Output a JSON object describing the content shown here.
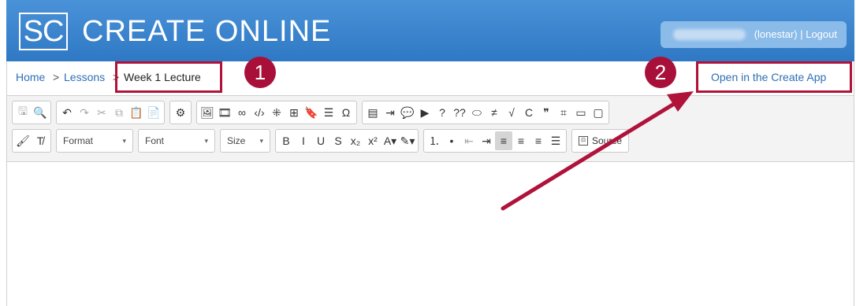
{
  "header": {
    "logo_text": "SC",
    "app_name": "CREATE ONLINE",
    "user_text": "(lonestar) | Logout"
  },
  "breadcrumb": {
    "home": "Home",
    "sep1": ">",
    "lessons": "Lessons",
    "sep2": ">",
    "current": "Week 1 Lecture"
  },
  "open_app_link": "Open in the Create App",
  "callouts": {
    "badge1": "1",
    "badge2": "2",
    "highlight_color": "#b0123a",
    "badge_color": "#a8103a"
  },
  "toolbar": {
    "format_label": "Format",
    "font_label": "Font",
    "size_label": "Size",
    "source_label": "Source",
    "row1_groups": [
      [
        {
          "icon": "save-icon",
          "glyph": "🖫",
          "disabled": true
        },
        {
          "icon": "preview-icon",
          "glyph": "🔍",
          "disabled": false
        }
      ],
      [
        {
          "icon": "undo-icon",
          "glyph": "↶",
          "disabled": false
        },
        {
          "icon": "redo-icon",
          "glyph": "↷",
          "disabled": true
        },
        {
          "icon": "cut-icon",
          "glyph": "✂",
          "disabled": true
        },
        {
          "icon": "copy-icon",
          "glyph": "⧉",
          "disabled": true
        },
        {
          "icon": "paste-icon",
          "glyph": "📋",
          "disabled": true
        },
        {
          "icon": "paste-text-icon",
          "glyph": "📄",
          "disabled": true
        }
      ],
      [
        {
          "icon": "gear-icon",
          "glyph": "⚙",
          "disabled": false
        }
      ],
      [
        {
          "icon": "image-icon",
          "glyph": "🖼",
          "disabled": false
        },
        {
          "icon": "media-icon",
          "glyph": "🎞",
          "disabled": false
        },
        {
          "icon": "link-icon",
          "glyph": "∞",
          "disabled": false
        },
        {
          "icon": "code-icon",
          "glyph": "‹/›",
          "disabled": false
        },
        {
          "icon": "widget-icon",
          "glyph": "⁜",
          "disabled": false
        },
        {
          "icon": "table-icon",
          "glyph": "⊞",
          "disabled": false
        },
        {
          "icon": "bookmark-icon",
          "glyph": "🔖",
          "disabled": false
        },
        {
          "icon": "horizontal-line-icon",
          "glyph": "☰",
          "disabled": false
        },
        {
          "icon": "omega-icon",
          "glyph": "Ω",
          "disabled": false
        }
      ],
      [
        {
          "icon": "template-icon",
          "glyph": "▤",
          "disabled": false
        },
        {
          "icon": "list-insert-icon",
          "glyph": "⇥",
          "disabled": false
        },
        {
          "icon": "comment-icon",
          "glyph": "💬",
          "disabled": false
        },
        {
          "icon": "play-icon",
          "glyph": "▶",
          "disabled": false
        },
        {
          "icon": "question-icon",
          "glyph": "?",
          "disabled": false
        },
        {
          "icon": "double-question-icon",
          "glyph": "??",
          "disabled": false
        },
        {
          "icon": "callout-icon",
          "glyph": "⬭",
          "disabled": false
        },
        {
          "icon": "strike-list-icon",
          "glyph": "≠",
          "disabled": false
        },
        {
          "icon": "sqrt-icon",
          "glyph": "√",
          "disabled": false
        },
        {
          "icon": "chemistry-icon",
          "glyph": "C",
          "disabled": false
        },
        {
          "icon": "quote-icon",
          "glyph": "❞",
          "disabled": false
        },
        {
          "icon": "div-icon",
          "glyph": "⌗",
          "disabled": false
        },
        {
          "icon": "layout-icon",
          "glyph": "▭",
          "disabled": false
        },
        {
          "icon": "frame-icon",
          "glyph": "▢",
          "disabled": false
        }
      ]
    ],
    "row2_left": [
      {
        "icon": "paintbrush-icon",
        "glyph": "🖌"
      },
      {
        "icon": "clear-format-icon",
        "glyph": "T̸"
      }
    ],
    "row2_format": [
      {
        "icon": "bold-icon",
        "glyph": "B"
      },
      {
        "icon": "italic-icon",
        "glyph": "I"
      },
      {
        "icon": "underline-icon",
        "glyph": "U"
      },
      {
        "icon": "strikethrough-icon",
        "glyph": "S"
      },
      {
        "icon": "subscript-icon",
        "glyph": "x₂"
      },
      {
        "icon": "superscript-icon",
        "glyph": "x²"
      },
      {
        "icon": "text-color-icon",
        "glyph": "A▾"
      },
      {
        "icon": "highlight-color-icon",
        "glyph": "✎▾"
      }
    ],
    "row2_align": [
      {
        "icon": "numbered-list-icon",
        "glyph": "⒈",
        "disabled": false
      },
      {
        "icon": "bullet-list-icon",
        "glyph": "•",
        "disabled": false
      },
      {
        "icon": "outdent-icon",
        "glyph": "⇤",
        "disabled": true
      },
      {
        "icon": "indent-icon",
        "glyph": "⇥",
        "disabled": false
      },
      {
        "icon": "align-left-icon",
        "glyph": "≡",
        "active": true
      },
      {
        "icon": "align-center-icon",
        "glyph": "≡"
      },
      {
        "icon": "align-right-icon",
        "glyph": "≡"
      },
      {
        "icon": "justify-icon",
        "glyph": "☰"
      }
    ]
  }
}
